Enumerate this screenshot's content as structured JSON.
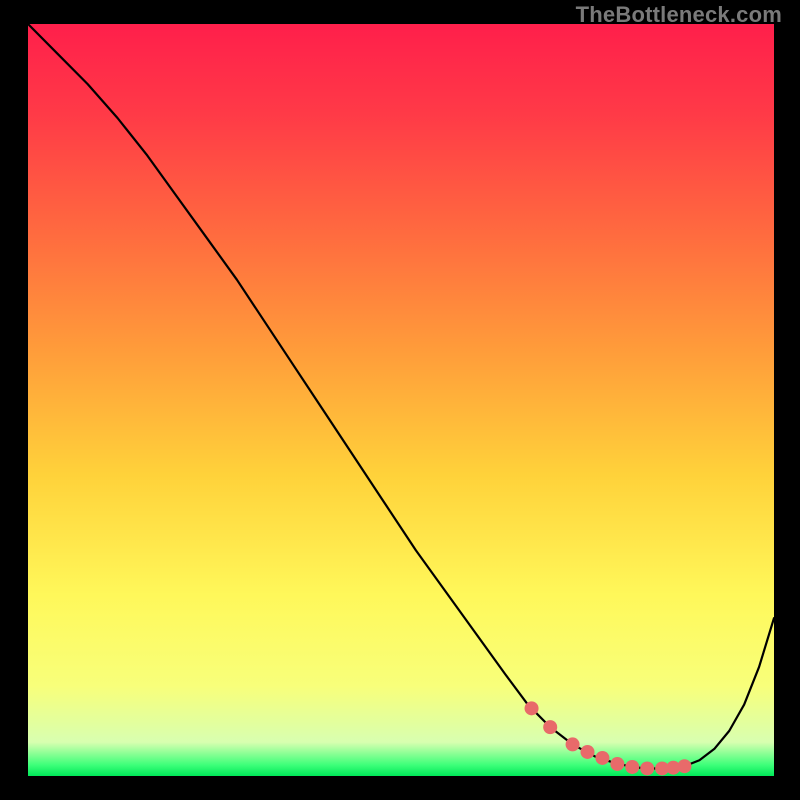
{
  "watermark": "TheBottleneck.com",
  "colors": {
    "background_black": "#000000",
    "curve_stroke": "#000000",
    "marker_fill": "#e86a6a",
    "gradient_stops": [
      {
        "offset": 0.0,
        "color": "#ff1f4b"
      },
      {
        "offset": 0.12,
        "color": "#ff3a47"
      },
      {
        "offset": 0.28,
        "color": "#ff6b3f"
      },
      {
        "offset": 0.44,
        "color": "#ff9e3a"
      },
      {
        "offset": 0.6,
        "color": "#ffd23a"
      },
      {
        "offset": 0.76,
        "color": "#fff85a"
      },
      {
        "offset": 0.88,
        "color": "#f8ff7a"
      },
      {
        "offset": 0.955,
        "color": "#d8ffb0"
      },
      {
        "offset": 0.985,
        "color": "#3fff7a"
      },
      {
        "offset": 1.0,
        "color": "#00e858"
      }
    ]
  },
  "chart_data": {
    "type": "line",
    "title": "",
    "xlabel": "",
    "ylabel": "",
    "xlim": [
      0,
      100
    ],
    "ylim": [
      0,
      100
    ],
    "series": [
      {
        "name": "bottleneck-curve",
        "x": [
          0,
          4,
          8,
          12,
          16,
          20,
          24,
          28,
          32,
          36,
          40,
          44,
          48,
          52,
          56,
          60,
          64,
          67,
          70,
          73,
          76,
          79,
          82,
          84,
          86,
          88,
          90,
          92,
          94,
          96,
          98,
          100
        ],
        "y": [
          100,
          96,
          92,
          87.5,
          82.5,
          77,
          71.5,
          66,
          60,
          54,
          48,
          42,
          36,
          30,
          24.5,
          19,
          13.5,
          9.5,
          6.5,
          4.2,
          2.6,
          1.6,
          1.1,
          1.0,
          1.0,
          1.3,
          2.1,
          3.6,
          6.0,
          9.5,
          14.5,
          21
        ]
      }
    ],
    "markers": {
      "series": "bottleneck-curve",
      "x": [
        67.5,
        70,
        73,
        75,
        77,
        79,
        81,
        83,
        85,
        86.5,
        88
      ],
      "y": [
        9.0,
        6.5,
        4.2,
        3.2,
        2.4,
        1.6,
        1.2,
        1.0,
        1.0,
        1.1,
        1.3
      ],
      "radius_px": 7
    }
  }
}
